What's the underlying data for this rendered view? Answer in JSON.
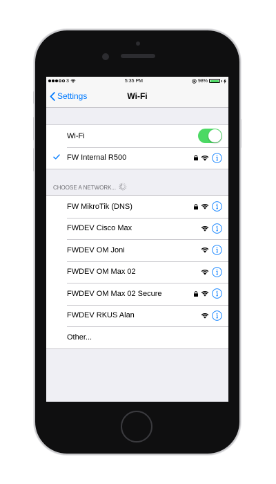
{
  "status_bar": {
    "carrier": "3",
    "time": "5:35 PM",
    "battery_percent": "98%",
    "battery_level": 0.98
  },
  "nav": {
    "back_label": "Settings",
    "title": "Wi-Fi"
  },
  "wifi_toggle": {
    "label": "Wi-Fi",
    "on": true
  },
  "connected_network": {
    "name": "FW Internal R500",
    "locked": true
  },
  "section_header": "CHOOSE A NETWORK...",
  "networks": [
    {
      "name": "FW MikroTik (DNS)",
      "locked": true
    },
    {
      "name": "FWDEV Cisco Max",
      "locked": false
    },
    {
      "name": "FWDEV OM Joni",
      "locked": false
    },
    {
      "name": "FWDEV OM Max 02",
      "locked": false
    },
    {
      "name": "FWDEV OM Max 02 Secure",
      "locked": true
    },
    {
      "name": "FWDEV RKUS Alan",
      "locked": false
    }
  ],
  "other_label": "Other...",
  "colors": {
    "accent": "#007aff",
    "toggle_on": "#4cd964",
    "background": "#efeff4",
    "device_body": "#0f0f10"
  },
  "icons": {
    "back": "chevron-left-icon",
    "check": "checkmark-icon",
    "lock": "lock-icon",
    "wifi": "wifi-signal-icon",
    "info": "info-icon",
    "spinner": "activity-spinner-icon"
  }
}
